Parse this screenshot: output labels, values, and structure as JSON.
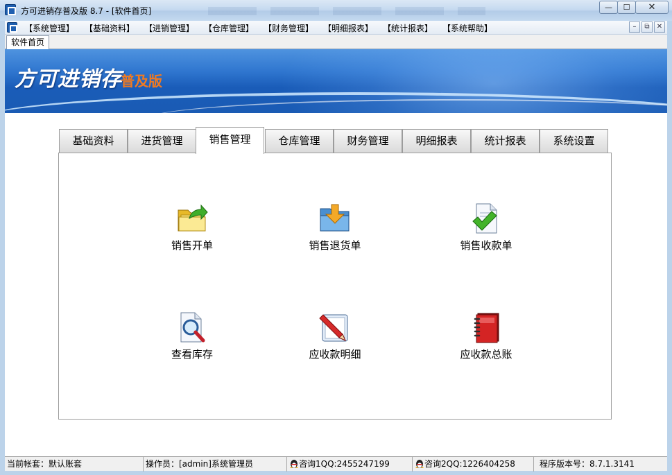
{
  "window": {
    "title": "方可进销存普及版 8.7 - [软件首页]",
    "min_symbol": "—",
    "max_symbol": "☐",
    "close_symbol": "✕"
  },
  "menu": {
    "items": [
      {
        "label": "【系统管理】"
      },
      {
        "label": "【基础资料】"
      },
      {
        "label": "【进销管理】"
      },
      {
        "label": "【仓库管理】"
      },
      {
        "label": "【财务管理】"
      },
      {
        "label": "【明细报表】"
      },
      {
        "label": "【统计报表】"
      },
      {
        "label": "【系统帮助】"
      }
    ],
    "mdi_min": "–",
    "mdi_restore": "⧉",
    "mdi_close": "✕"
  },
  "doc_tab": {
    "label": "软件首页"
  },
  "banner": {
    "title": "方可进销存",
    "subtitle": "普及版"
  },
  "tabs": [
    {
      "label": "基础资料",
      "active": false
    },
    {
      "label": "进货管理",
      "active": false
    },
    {
      "label": "销售管理",
      "active": true
    },
    {
      "label": "仓库管理",
      "active": false
    },
    {
      "label": "财务管理",
      "active": false
    },
    {
      "label": "明细报表",
      "active": false
    },
    {
      "label": "统计报表",
      "active": false
    },
    {
      "label": "系统设置",
      "active": false
    }
  ],
  "functions": [
    {
      "label": "销售开单",
      "icon": "folder-export-icon"
    },
    {
      "label": "销售退货单",
      "icon": "folder-import-icon"
    },
    {
      "label": "销售收款单",
      "icon": "document-check-icon"
    },
    {
      "label": "查看库存",
      "icon": "document-search-icon"
    },
    {
      "label": "应收款明细",
      "icon": "pencil-edit-icon"
    },
    {
      "label": "应收款总账",
      "icon": "ledger-book-icon"
    }
  ],
  "status": {
    "account": "当前帐套：默认账套",
    "operator": "操作员：[admin]系统管理员",
    "qq1": "咨询1QQ:2455247199",
    "qq2": "咨询2QQ:1226404258",
    "version": "程序版本号：8.7.1.3141"
  },
  "colors": {
    "banner_blue": "#1a5cb8",
    "subtitle_orange": "#f07a22",
    "window_chrome": "#bcd3ea"
  }
}
